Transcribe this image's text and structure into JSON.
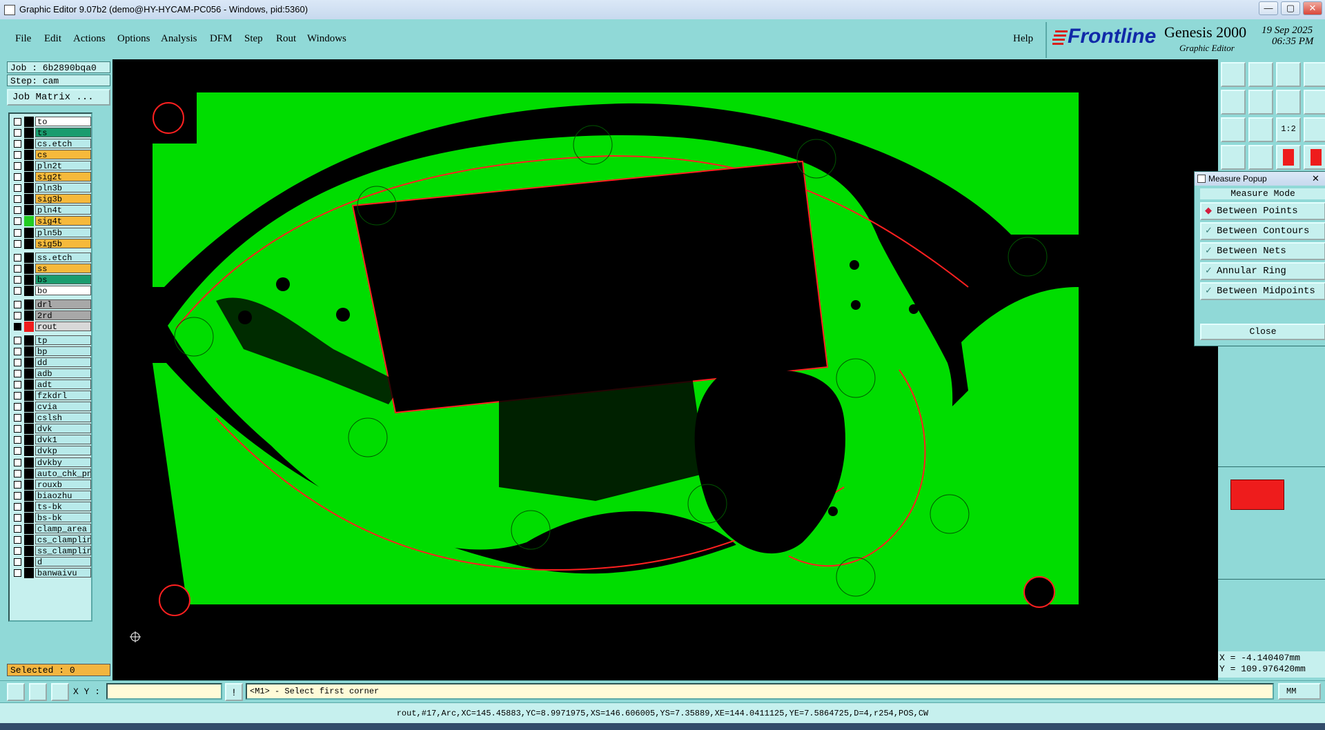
{
  "window": {
    "title": "Graphic Editor 9.07b2 (demo@HY-HYCAM-PC056 - Windows, pid:5360)",
    "controls": [
      "—",
      "▢",
      "✕"
    ]
  },
  "menubar": {
    "items": [
      "File",
      "Edit",
      "Actions",
      "Options",
      "Analysis",
      "DFM",
      "Step",
      "Rout",
      "Windows"
    ],
    "help": "Help"
  },
  "logo": {
    "brand": "Frontline",
    "product": "Genesis 2000",
    "subtitle": "Graphic Editor",
    "date": "19 Sep 2025",
    "time": "06:35 PM"
  },
  "job": {
    "job_label": "Job : 6b2890bqa0",
    "step_label": "Step: cam",
    "matrix_button": "Job Matrix ..."
  },
  "layers": [
    {
      "name": "to",
      "color": "#ffffff"
    },
    {
      "name": "ts",
      "color": "#1a9c6e"
    },
    {
      "name": "cs.etch",
      "color": "#b8eaea"
    },
    {
      "name": "cs",
      "color": "#f6b93b"
    },
    {
      "name": "pln2t",
      "color": "#b8eaea"
    },
    {
      "name": "sig2t",
      "color": "#f6b93b"
    },
    {
      "name": "pln3b",
      "color": "#b8eaea"
    },
    {
      "name": "sig3b",
      "color": "#f6b93b"
    },
    {
      "name": "pln4t",
      "color": "#b8eaea"
    },
    {
      "name": "sig4t",
      "color": "#f6b93b",
      "swatch": "#22cc22"
    },
    {
      "name": "pln5b",
      "color": "#b8eaea"
    },
    {
      "name": "sig5b",
      "color": "#f6b93b"
    },
    {
      "name": "ss.etch",
      "color": "#b8eaea"
    },
    {
      "name": "ss",
      "color": "#f6b93b"
    },
    {
      "name": "bs",
      "color": "#1a9c6e"
    },
    {
      "name": "bo",
      "color": "#ffffff"
    },
    {
      "name": "drl",
      "color": "#a8a8a8"
    },
    {
      "name": "2rd",
      "color": "#a8a8a8"
    },
    {
      "name": "rout",
      "color": "#d8d8d8",
      "swatch": "#ee1c1c",
      "active": true
    },
    {
      "name": "tp",
      "color": "#b8eaea"
    },
    {
      "name": "bp",
      "color": "#b8eaea"
    },
    {
      "name": "dd",
      "color": "#b8eaea"
    },
    {
      "name": "adb",
      "color": "#b8eaea"
    },
    {
      "name": "adt",
      "color": "#b8eaea"
    },
    {
      "name": "fzkdrl",
      "color": "#b8eaea"
    },
    {
      "name": "cvia",
      "color": "#b8eaea"
    },
    {
      "name": "cslsh",
      "color": "#b8eaea"
    },
    {
      "name": "dvk",
      "color": "#b8eaea"
    },
    {
      "name": "dvk1",
      "color": "#b8eaea"
    },
    {
      "name": "dvkp",
      "color": "#b8eaea"
    },
    {
      "name": "dvkby",
      "color": "#b8eaea"
    },
    {
      "name": "auto_chk_pn",
      "color": "#b8eaea"
    },
    {
      "name": "rouxb",
      "color": "#b8eaea"
    },
    {
      "name": "biaozhu",
      "color": "#b8eaea"
    },
    {
      "name": "ts-bk",
      "color": "#b8eaea"
    },
    {
      "name": "bs-bk",
      "color": "#b8eaea"
    },
    {
      "name": "clamp_area",
      "color": "#b8eaea"
    },
    {
      "name": "cs_clampline",
      "color": "#b8eaea"
    },
    {
      "name": "ss_clampline",
      "color": "#b8eaea"
    },
    {
      "name": "d",
      "color": "#b8eaea"
    },
    {
      "name": "banwaivu",
      "color": "#b8eaea"
    }
  ],
  "selected": "Selected : 0",
  "toolbox": {
    "icons": [
      "open-step-icon",
      "save-icon",
      "home-icon",
      "window-icon",
      "prev-view-icon",
      "next-view-icon",
      "swap-icon",
      "redraw-icon",
      "fit-icon",
      "zoom-icon",
      "scale-1to1-label",
      "help-icon",
      "ruler-icon",
      "snap-icon",
      "layer-red-icon",
      "layer-red2-icon"
    ],
    "scale_label": "1:2"
  },
  "measure_popup": {
    "title": "Measure Popup",
    "header": "Measure Mode",
    "options": [
      "Between Points",
      "Between Contours",
      "Between Nets",
      "Annular Ring",
      "Between Midpoints"
    ],
    "selected_index": 0,
    "close": "Close"
  },
  "coords": {
    "x": "X = -4.140407mm",
    "y": "Y = 109.976420mm"
  },
  "commandbar": {
    "xy_label": "X Y :",
    "xy_value": "",
    "prompt": "<M1> - Select first corner",
    "unit": "MM"
  },
  "statusbar": {
    "text": "rout,#17,Arc,XC=145.45883,YC=8.9971975,XS=146.606005,YS=7.35889,XE=144.0411125,YE=7.5864725,D=4,r254,POS,CW"
  },
  "colors": {
    "ui_teal": "#90d9d7",
    "ui_light": "#c6f0ee",
    "board_green": "#00dd00",
    "rout_red": "#ff0000"
  }
}
